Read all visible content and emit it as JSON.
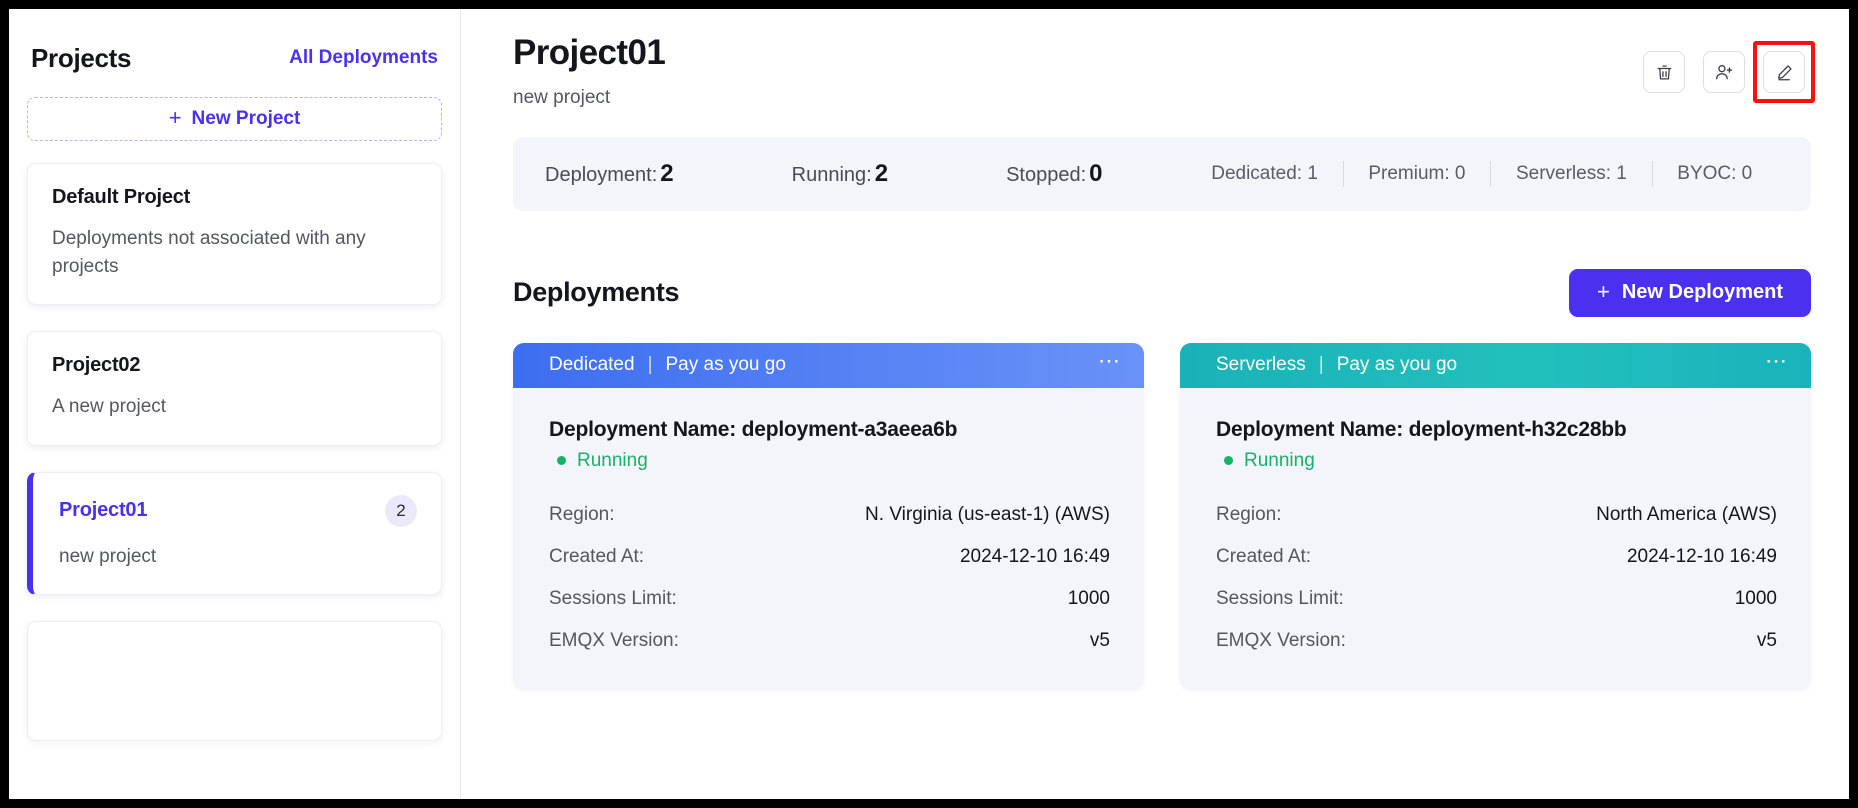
{
  "sidebar": {
    "title": "Projects",
    "all_deployments_label": "All Deployments",
    "new_project_label": "New Project",
    "projects": [
      {
        "name": "Default Project",
        "description": "Deployments not associated with any projects",
        "count": ""
      },
      {
        "name": "Project02",
        "description": "A new project",
        "count": ""
      },
      {
        "name": "Project01",
        "description": "new project",
        "count": "2"
      }
    ]
  },
  "header": {
    "title": "Project01",
    "subtitle": "new project",
    "actions": [
      {
        "name": "delete-project-button",
        "icon": "trash-icon"
      },
      {
        "name": "add-member-button",
        "icon": "person-add-icon"
      },
      {
        "name": "edit-project-button",
        "icon": "pencil-icon"
      }
    ]
  },
  "stats": {
    "deployment_label": "Deployment:",
    "deployment_value": "2",
    "running_label": "Running:",
    "running_value": "2",
    "stopped_label": "Stopped:",
    "stopped_value": "0",
    "dedicated": "Dedicated: 1",
    "premium": "Premium: 0",
    "serverless": "Serverless: 1",
    "byoc": "BYOC: 0"
  },
  "deployments_section": {
    "title": "Deployments",
    "new_deployment_label": "New Deployment"
  },
  "deployments": [
    {
      "type": "Dedicated",
      "divider": "|",
      "billing": "Pay as you go",
      "name": "Deployment Name: deployment-a3aeea6b",
      "status": "Running",
      "rows": [
        {
          "key": "Region:",
          "value": "N. Virginia (us-east-1) (AWS)"
        },
        {
          "key": "Created At:",
          "value": "2024-12-10 16:49"
        },
        {
          "key": "Sessions Limit:",
          "value": "1000"
        },
        {
          "key": "EMQX Version:",
          "value": "v5"
        }
      ]
    },
    {
      "type": "Serverless",
      "divider": "|",
      "billing": "Pay as you go",
      "name": "Deployment Name: deployment-h32c28bb",
      "status": "Running",
      "rows": [
        {
          "key": "Region:",
          "value": "North America (AWS)"
        },
        {
          "key": "Created At:",
          "value": "2024-12-10 16:49"
        },
        {
          "key": "Sessions Limit:",
          "value": "1000"
        },
        {
          "key": "EMQX Version:",
          "value": "v5"
        }
      ]
    }
  ],
  "colors": {
    "accent": "#4a31f0",
    "dedicated_start": "#3d6ef0",
    "dedicated_end": "#6a92f7",
    "serverless_start": "#1ab2b8",
    "serverless_end": "#22c0bd",
    "status_running": "#17b26a",
    "highlight": "#fb0f0f",
    "panel_bg": "#f4f5fa"
  }
}
